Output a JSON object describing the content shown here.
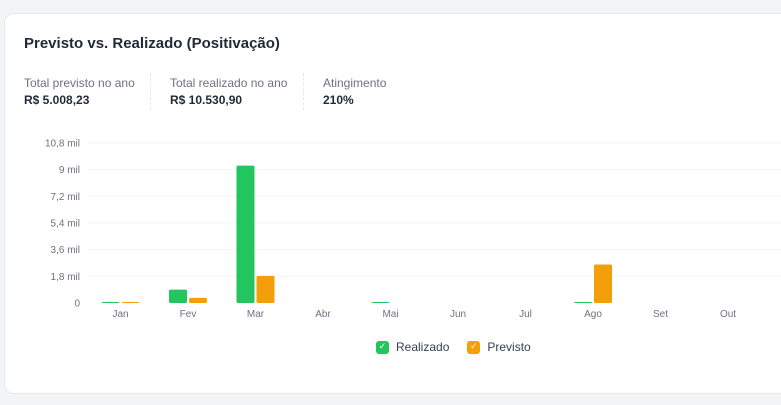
{
  "card": {
    "title": "Previsto vs. Realizado (Positivação)"
  },
  "metrics": [
    {
      "label": "Total previsto no ano",
      "value": "R$ 5.008,23"
    },
    {
      "label": "Total realizado no ano",
      "value": "R$ 10.530,90"
    },
    {
      "label": "Atingimento",
      "value": "210%"
    }
  ],
  "legend": {
    "realizado_label": "Realizado",
    "previsto_label": "Previsto",
    "check_icon": "check-icon"
  },
  "colors": {
    "realizado": "#22c55e",
    "previsto": "#f59e0b",
    "grid": "#f3f4f6",
    "axis_text": "#6b7280"
  },
  "chart_data": {
    "type": "bar",
    "title": "Previsto vs. Realizado (Positivação)",
    "categories": [
      "Jan",
      "Fev",
      "Mar",
      "Abr",
      "Mai",
      "Jun",
      "Jul",
      "Ago",
      "Set",
      "Out"
    ],
    "series": [
      {
        "name": "Realizado",
        "values": [
          20,
          900,
          9270,
          0,
          60,
          0,
          0,
          30,
          0,
          0
        ]
      },
      {
        "name": "Previsto",
        "values": [
          20,
          350,
          1830,
          0,
          0,
          0,
          0,
          2600,
          0,
          0
        ]
      }
    ],
    "ylim": [
      0,
      10800
    ],
    "yticks": [
      {
        "value": 0,
        "label": "0"
      },
      {
        "value": 1800,
        "label": "1,8 mil"
      },
      {
        "value": 3600,
        "label": "3,6 mil"
      },
      {
        "value": 5400,
        "label": "5,4 mil"
      },
      {
        "value": 7200,
        "label": "7,2 mil"
      },
      {
        "value": 9000,
        "label": "9 mil"
      },
      {
        "value": 10800,
        "label": "10,8 mil"
      }
    ],
    "grid": true,
    "legend_position": "bottom-center"
  }
}
